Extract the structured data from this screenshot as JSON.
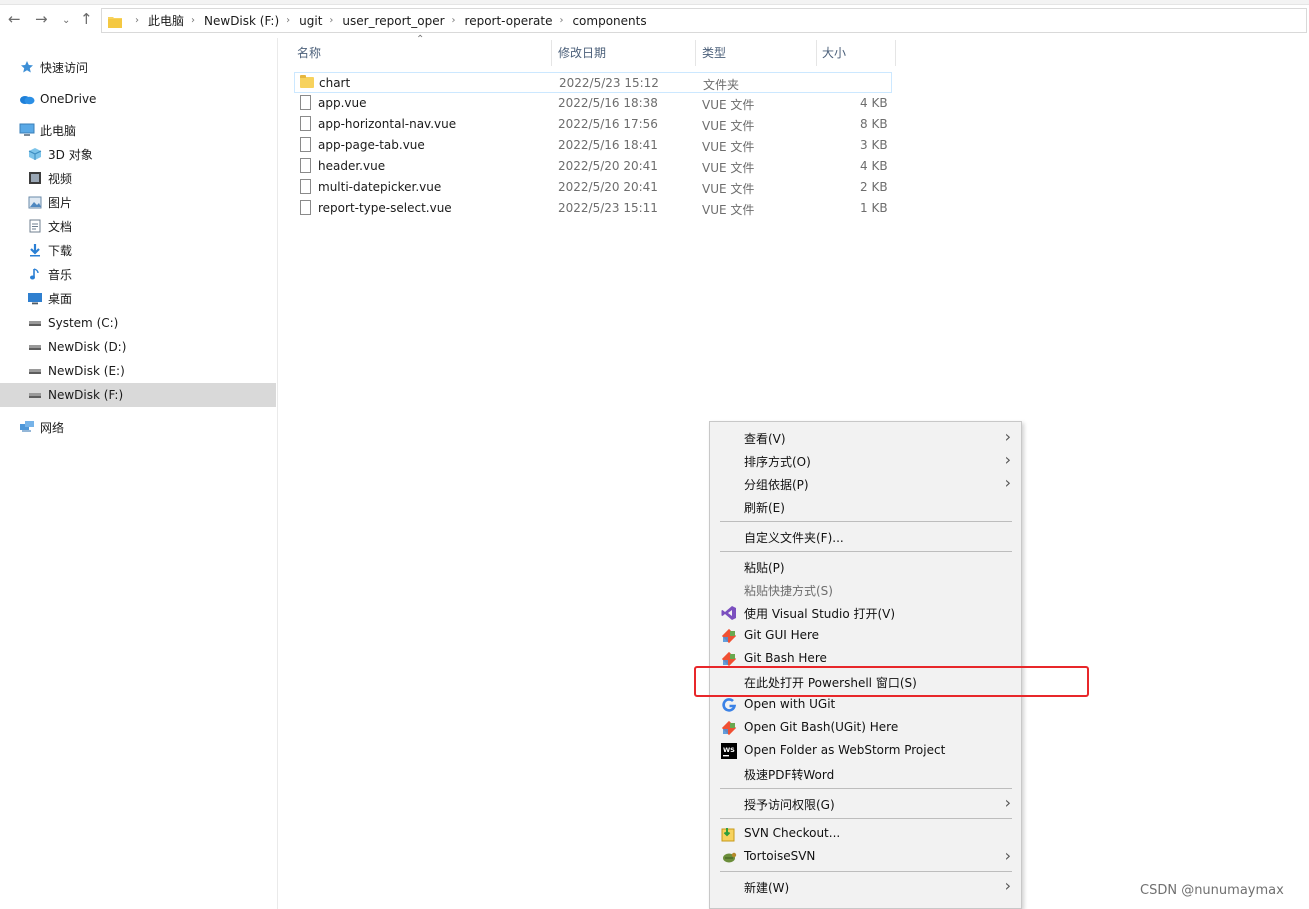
{
  "breadcrumb": [
    "此电脑",
    "NewDisk (F:)",
    "ugit",
    "user_report_oper",
    "report-operate",
    "components"
  ],
  "sidebar": {
    "items": [
      {
        "label": "快速访问",
        "icon": "star-icon",
        "indent": 0
      },
      {
        "label": "OneDrive",
        "icon": "cloud-icon",
        "indent": 0
      },
      {
        "label": "此电脑",
        "icon": "computer-icon",
        "indent": 0
      },
      {
        "label": "3D 对象",
        "icon": "cube-icon",
        "indent": 1
      },
      {
        "label": "视频",
        "icon": "video-icon",
        "indent": 1
      },
      {
        "label": "图片",
        "icon": "picture-icon",
        "indent": 1
      },
      {
        "label": "文档",
        "icon": "document-icon",
        "indent": 1
      },
      {
        "label": "下载",
        "icon": "download-icon",
        "indent": 1
      },
      {
        "label": "音乐",
        "icon": "music-icon",
        "indent": 1
      },
      {
        "label": "桌面",
        "icon": "desktop-icon",
        "indent": 1
      },
      {
        "label": "System (C:)",
        "icon": "drive-icon",
        "indent": 1
      },
      {
        "label": "NewDisk (D:)",
        "icon": "drive-icon",
        "indent": 1
      },
      {
        "label": "NewDisk (E:)",
        "icon": "drive-icon",
        "indent": 1
      },
      {
        "label": "NewDisk (F:)",
        "icon": "drive-icon",
        "indent": 1,
        "selected": true
      },
      {
        "label": "网络",
        "icon": "network-icon",
        "indent": 0
      }
    ]
  },
  "columns": {
    "name": "名称",
    "date": "修改日期",
    "type": "类型",
    "size": "大小"
  },
  "files": [
    {
      "name": "chart",
      "date": "2022/5/23 15:12",
      "type": "文件夹",
      "size": "",
      "folder": true
    },
    {
      "name": "app.vue",
      "date": "2022/5/16 18:38",
      "type": "VUE 文件",
      "size": "4 KB"
    },
    {
      "name": "app-horizontal-nav.vue",
      "date": "2022/5/16 17:56",
      "type": "VUE 文件",
      "size": "8 KB"
    },
    {
      "name": "app-page-tab.vue",
      "date": "2022/5/16 18:41",
      "type": "VUE 文件",
      "size": "3 KB"
    },
    {
      "name": "header.vue",
      "date": "2022/5/20 20:41",
      "type": "VUE 文件",
      "size": "4 KB"
    },
    {
      "name": "multi-datepicker.vue",
      "date": "2022/5/20 20:41",
      "type": "VUE 文件",
      "size": "2 KB"
    },
    {
      "name": "report-type-select.vue",
      "date": "2022/5/23 15:11",
      "type": "VUE 文件",
      "size": "1 KB"
    }
  ],
  "context_menu": [
    {
      "kind": "item",
      "label": "查看(V)",
      "submenu": true
    },
    {
      "kind": "item",
      "label": "排序方式(O)",
      "submenu": true
    },
    {
      "kind": "item",
      "label": "分组依据(P)",
      "submenu": true
    },
    {
      "kind": "item",
      "label": "刷新(E)"
    },
    {
      "kind": "sep"
    },
    {
      "kind": "item",
      "label": "自定义文件夹(F)..."
    },
    {
      "kind": "sep"
    },
    {
      "kind": "item",
      "label": "粘贴(P)"
    },
    {
      "kind": "item",
      "label": "粘贴快捷方式(S)",
      "disabled": true
    },
    {
      "kind": "item",
      "label": "使用 Visual Studio 打开(V)",
      "icon": "visual-studio-icon"
    },
    {
      "kind": "item",
      "label": "Git GUI Here",
      "icon": "git-icon"
    },
    {
      "kind": "item",
      "label": "Git Bash Here",
      "icon": "git-icon"
    },
    {
      "kind": "item",
      "label": "在此处打开 Powershell 窗口(S)",
      "highlighted": true
    },
    {
      "kind": "item",
      "label": "Open with UGit",
      "icon": "ugit-icon"
    },
    {
      "kind": "item",
      "label": "Open Git Bash(UGit) Here",
      "icon": "git-icon"
    },
    {
      "kind": "item",
      "label": "Open Folder as WebStorm Project",
      "icon": "webstorm-icon"
    },
    {
      "kind": "item",
      "label": "极速PDF转Word"
    },
    {
      "kind": "sep"
    },
    {
      "kind": "item",
      "label": "授予访问权限(G)",
      "submenu": true
    },
    {
      "kind": "sep"
    },
    {
      "kind": "item",
      "label": "SVN Checkout...",
      "icon": "svn-checkout-icon"
    },
    {
      "kind": "item",
      "label": "TortoiseSVN",
      "icon": "tortoisesvn-icon",
      "submenu": true
    },
    {
      "kind": "sep"
    },
    {
      "kind": "item",
      "label": "新建(W)",
      "submenu": true
    }
  ],
  "watermark": "CSDN @nunumaymax",
  "colors": {
    "selection": "#d9d9d9",
    "highlight_box": "#e8272a",
    "folder": "#f7d25d",
    "accent": "#0078d7"
  }
}
